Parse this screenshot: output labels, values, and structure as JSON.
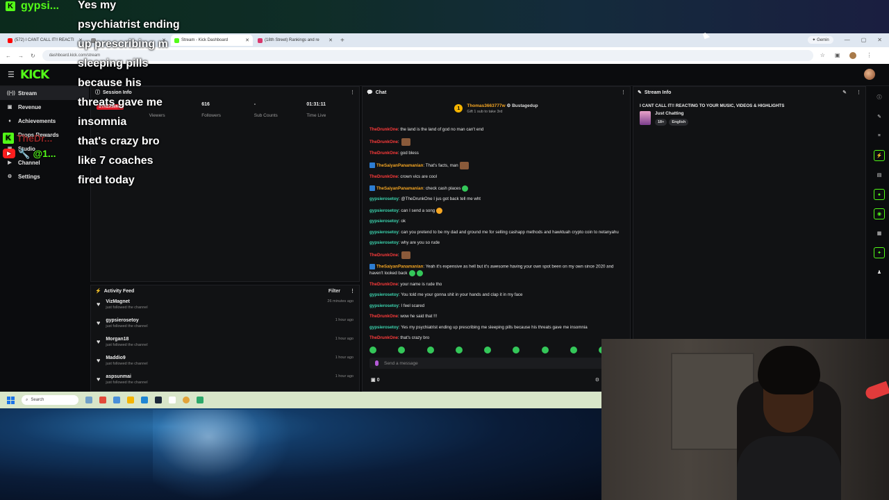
{
  "overlay": {
    "top_username": "gypsi...",
    "messages": [
      "Yes my",
      "psychiatrist ending",
      "up prescribing m",
      "sleeping pills",
      "because his",
      "threats gave me",
      "insomnia",
      "that's crazy bro",
      "like 7 coaches",
      "fired today"
    ],
    "side_user1": "TheDr...",
    "side_user2": "@1..."
  },
  "browser": {
    "tabs": [
      {
        "label": "(572) I CANT CALL IT!! REACTI",
        "color": "#ff0000"
      },
      {
        "label": "",
        "color": "#888888"
      },
      {
        "label": "Stream - Kick Dashboard",
        "color": "#53fc18"
      },
      {
        "label": "(18th Street) Rankings and re",
        "color": "#d9366b"
      }
    ],
    "gemini_label": "Gemin",
    "url": "dashboard.kick.com/stream"
  },
  "app": {
    "logo": "KICK",
    "sidebar": [
      {
        "icon": "((•))",
        "label": "Stream"
      },
      {
        "icon": "▣",
        "label": "Revenue"
      },
      {
        "icon": "♦",
        "label": "Achievements"
      },
      {
        "icon": "◆",
        "label": "Drops Rewards"
      },
      {
        "icon": "▣",
        "label": "Studio"
      },
      {
        "icon": "▶",
        "label": "Channel"
      },
      {
        "icon": "⚙",
        "label": "Settings"
      }
    ],
    "session": {
      "title": "Session Info",
      "live_badge": "STREAMING",
      "stats": [
        {
          "value": "7",
          "label": "Viewers"
        },
        {
          "value": "616",
          "label": "Followers"
        },
        {
          "value": "-",
          "label": "Sub Counts"
        },
        {
          "value": "01:31:11",
          "label": "Time Live"
        }
      ]
    },
    "activity": {
      "title": "Activity Feed",
      "filter": "Filter",
      "items": [
        {
          "name": "VizMagnet",
          "action": "just followed the channel",
          "time": "26 minutes ago"
        },
        {
          "name": "gypsierosetoy",
          "action": "just followed the channel",
          "time": "1 hour ago"
        },
        {
          "name": "Morgan18",
          "action": "just followed the channel",
          "time": "1 hour ago"
        },
        {
          "name": "Maddio9",
          "action": "just followed the channel",
          "time": "1 hour ago"
        },
        {
          "name": "aspsunmai",
          "action": "just followed the channel",
          "time": "1 hour ago"
        }
      ]
    },
    "chat": {
      "title": "Chat",
      "pinned_user": "Thomas3663777w",
      "pinned_user2": "Bustagedup",
      "pinned_note": "Gift 1 sub to take 3rd",
      "placeholder": "Send a message",
      "footer_count": "0",
      "messages": [
        {
          "user": "TheDrunkOne",
          "color": "#ff3b3b",
          "text": "the land is the land of god no man can't end"
        },
        {
          "user": "TheDrunkOne",
          "color": "#ff3b3b",
          "text": "",
          "emote": "img"
        },
        {
          "user": "TheDrunkOne",
          "color": "#ff3b3b",
          "text": "god bless"
        },
        {
          "user": "TheSaiyanPanamanian",
          "color": "#f5a623",
          "text": "That's facts, man",
          "emote": "img",
          "badge": true
        },
        {
          "user": "TheDrunkOne",
          "color": "#ff3b3b",
          "text": "crown vics are cool"
        },
        {
          "user": "TheSaiyanPanamanian",
          "color": "#f5a623",
          "text": "check cash places",
          "emote": "green",
          "badge": true
        },
        {
          "user": "gypsierosetoy",
          "color": "#3cd6b0",
          "text": "@TheDrunkOne I jus got back tell me wht"
        },
        {
          "user": "gypsierosetoy",
          "color": "#3cd6b0",
          "text": "can I send a song",
          "emote": "orange"
        },
        {
          "user": "gypsierosetoy",
          "color": "#3cd6b0",
          "text": "ok"
        },
        {
          "user": "gypsierosetoy",
          "color": "#3cd6b0",
          "text": "can you pretend to be my dad and ground me for selling cashapp methods and hawktuah crypto coin to netanyahu"
        },
        {
          "user": "gypsierosetoy",
          "color": "#3cd6b0",
          "text": "why are you so rude"
        },
        {
          "user": "TheDrunkOne",
          "color": "#ff3b3b",
          "text": "",
          "emote": "img"
        },
        {
          "user": "TheSaiyanPanamanian",
          "color": "#f5a623",
          "text": "Yeah it's expensive as hell but it's awesome having your own spot been on my own since 2020 and haven't looked back",
          "emote": "green2",
          "badge": true
        },
        {
          "user": "TheDrunkOne",
          "color": "#ff3b3b",
          "text": "your name is rude tho"
        },
        {
          "user": "gypsierosetoy",
          "color": "#3cd6b0",
          "text": "You told me your gonna shit in your hands and clap it in my face"
        },
        {
          "user": "gypsierosetoy",
          "color": "#3cd6b0",
          "text": "I feel scared"
        },
        {
          "user": "TheDrunkOne",
          "color": "#ff3b3b",
          "text": "wow he said that !!!"
        },
        {
          "user": "gypsierosetoy",
          "color": "#3cd6b0",
          "text": "Yes my psychiatrist ending up prescribing me sleeping pills because his threats gave me insomnia"
        },
        {
          "user": "TheDrunkOne",
          "color": "#ff3b3b",
          "text": "that's crazy bro"
        }
      ]
    },
    "stream_info": {
      "title": "Stream Info",
      "stream_title": "I CANT CALL IT!! REACTING TO YOUR MUSIC, VIDEOS & HIGHLIGHTS",
      "category": "Just Chatting",
      "tags": [
        "18+",
        "English"
      ]
    }
  },
  "taskbar": {
    "search": "Search"
  }
}
